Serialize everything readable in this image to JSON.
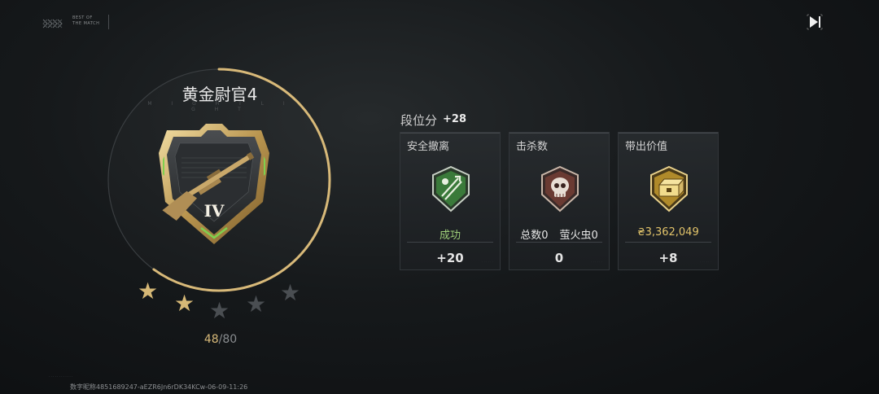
{
  "header": {
    "best_line1": "BEST OF",
    "best_line2": "THE MATCH",
    "skip_icon": "skip-forward-icon"
  },
  "rank": {
    "title": "黄金尉官4",
    "subtitle": "M I G H T   L I G H T",
    "tier": "IV",
    "stars_total": 5,
    "stars_filled": 2,
    "progress_current": "48",
    "progress_total": "/80",
    "progress_fraction": 0.6
  },
  "score": {
    "label": "段位分",
    "delta": "+28"
  },
  "cards": [
    {
      "title": "安全撤离",
      "icon": "extraction-badge-icon",
      "stat": "成功",
      "stat_color": "#9fd07a",
      "value": "+20"
    },
    {
      "title": "击杀数",
      "icon": "skull-badge-icon",
      "stat_a": "总数0",
      "stat_b": "萤火虫0",
      "stat_color": "#e6e6e6",
      "value": "0"
    },
    {
      "title": "带出价值",
      "icon": "loot-crate-badge-icon",
      "stat_icon": "coin-icon",
      "stat": "3,362,049",
      "stat_color": "#e2c46a",
      "value": "+8"
    }
  ],
  "footer": {
    "id_line": "数字昵称4851689247-aEZR6Jn6rDK34KCw-06-09-11:26"
  },
  "colors": {
    "gold": "#d8b979",
    "accent_green": "#9fd07a"
  }
}
